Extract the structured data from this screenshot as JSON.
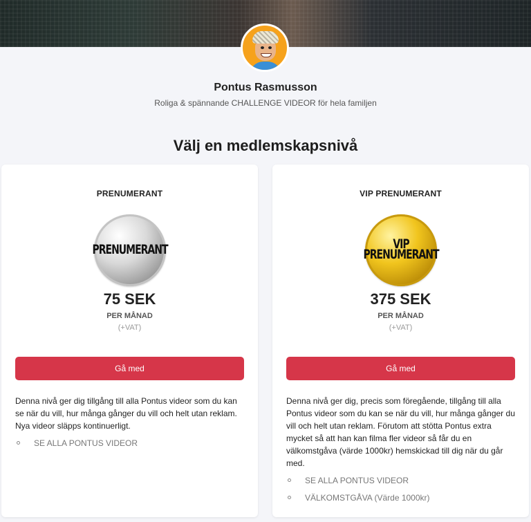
{
  "creator": {
    "name": "Pontus Rasmusson",
    "tagline": "Roliga & spännande CHALLENGE VIDEOR för hela familjen"
  },
  "section_title": "Välj en medlemskapsnivå",
  "tiers": [
    {
      "name": "PRENUMERANT",
      "badge_text": "PRENUMERANT",
      "badge_style": "silver",
      "price": "75 SEK",
      "period": "PER MÅNAD",
      "vat": "(+VAT)",
      "button_label": "Gå med",
      "description": "Denna nivå ger dig tillgång till alla Pontus videor som du kan se när du vill, hur många gånger du vill och helt utan reklam. Nya videor släpps kontinuerligt.",
      "perks": [
        "SE ALLA PONTUS VIDEOR"
      ]
    },
    {
      "name": "VIP PRENUMERANT",
      "badge_text_top": "VIP",
      "badge_text": "PRENUMERANT",
      "badge_style": "gold",
      "price": "375 SEK",
      "period": "PER MÅNAD",
      "vat": "(+VAT)",
      "button_label": "Gå med",
      "description": "Denna nivå ger dig, precis som föregående, tillgång till alla Pontus videor som du kan se när du vill, hur många gånger du vill och helt utan reklam. Förutom att stötta Pontus extra mycket så att han kan filma fler videor så får du en välkomstgåva (värde 1000kr) hemskickad till dig när du går med.",
      "perks": [
        "SE ALLA PONTUS VIDEOR",
        "VÄLKOMSTGÅVA (Värde 1000kr)"
      ]
    }
  ],
  "colors": {
    "background": "#f4f5f9",
    "button": "#d63649",
    "avatar_bg": "#f6a21c",
    "silver": "#c4c4c4",
    "gold": "#f1c51e"
  }
}
